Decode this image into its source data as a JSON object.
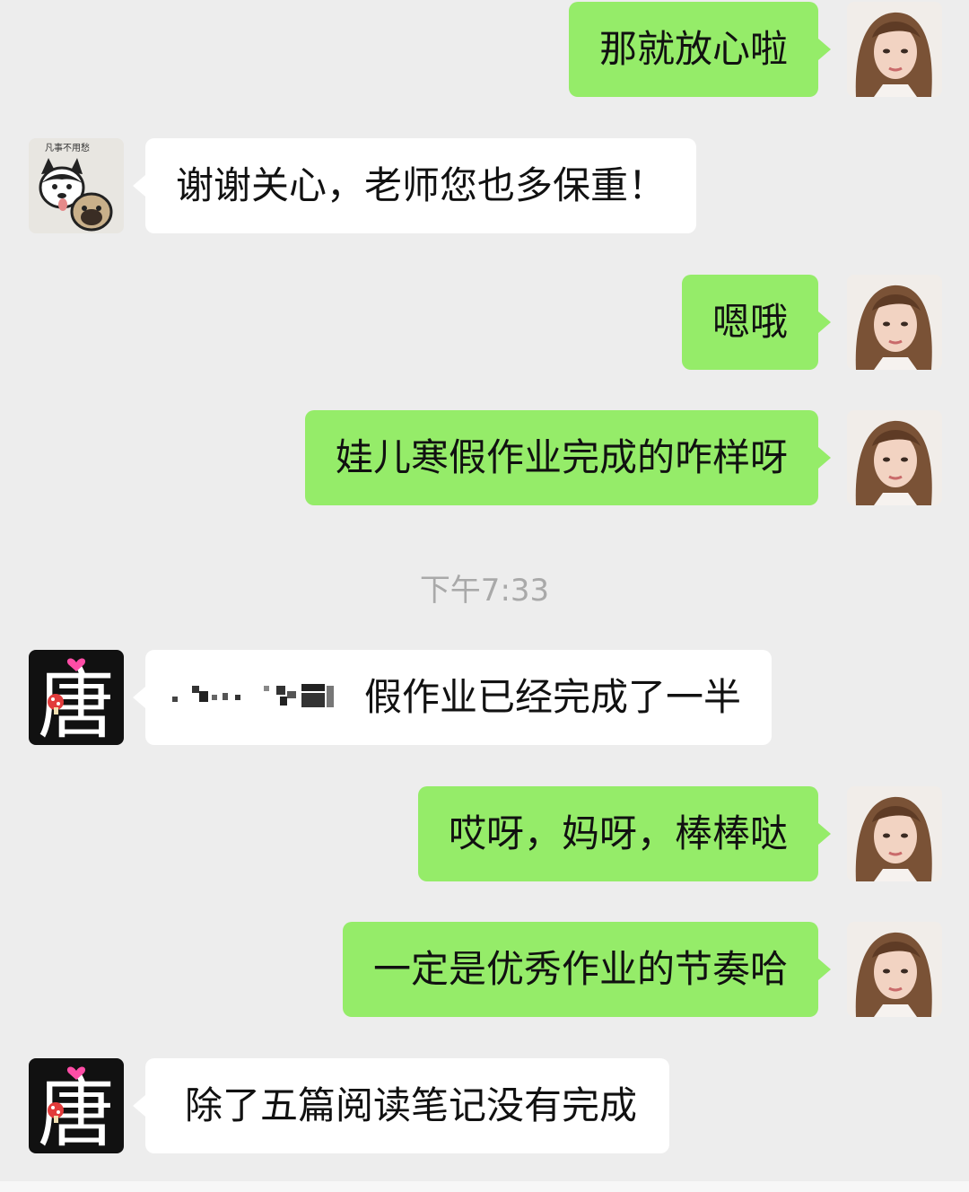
{
  "timestamp": "下午7:33",
  "messages": [
    {
      "side": "out",
      "avatar": "woman-avatar",
      "text": "那就放心啦"
    },
    {
      "side": "in",
      "avatar": "dogs-avatar",
      "text": "谢谢关心，老师您也多保重！",
      "avatar_caption": "凡事不用愁"
    },
    {
      "side": "out",
      "avatar": "woman-avatar",
      "text": "嗯哦"
    },
    {
      "side": "out",
      "avatar": "woman-avatar",
      "text": "娃儿寒假作业完成的咋样呀"
    },
    {
      "side": "in",
      "avatar": "tang-avatar",
      "text": "假作业已经完成了一半",
      "avatar_char": "唐"
    },
    {
      "side": "out",
      "avatar": "woman-avatar",
      "text": "哎呀，妈呀，棒棒哒"
    },
    {
      "side": "out",
      "avatar": "woman-avatar",
      "text": "一定是优秀作业的节奏哈"
    },
    {
      "side": "in",
      "avatar": "tang-avatar",
      "text": "除了五篇阅读笔记没有完成",
      "avatar_char": "唐"
    }
  ]
}
